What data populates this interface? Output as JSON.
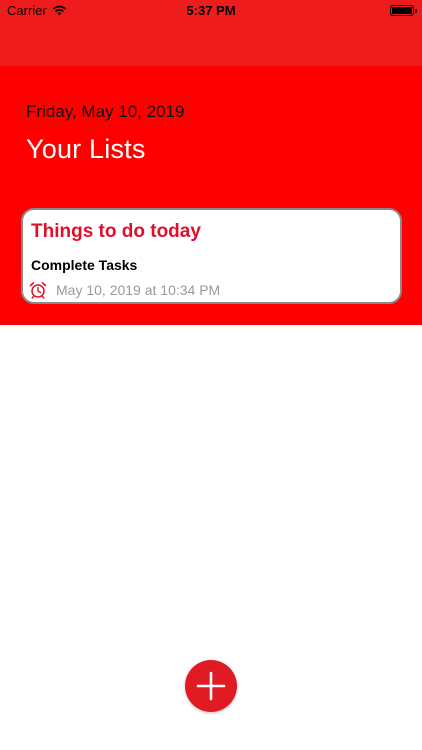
{
  "status_bar": {
    "carrier": "Carrier",
    "time": "5:37 PM",
    "battery_level": 1.0
  },
  "header": {
    "date": "Friday, May 10, 2019",
    "title": "Your Lists"
  },
  "lists": [
    {
      "title": "Things to do today",
      "task": "Complete Tasks",
      "reminder": "May 10, 2019 at 10:34 PM",
      "reminder_icon": "alarm-clock-icon"
    }
  ],
  "fab": {
    "icon": "plus-icon"
  },
  "colors": {
    "brand_red": "#ff0000",
    "nav_red": "#ee1c1c",
    "card_title": "#e0102a",
    "reminder_gray": "#9a9a9a",
    "fab_red": "#e01b24"
  }
}
